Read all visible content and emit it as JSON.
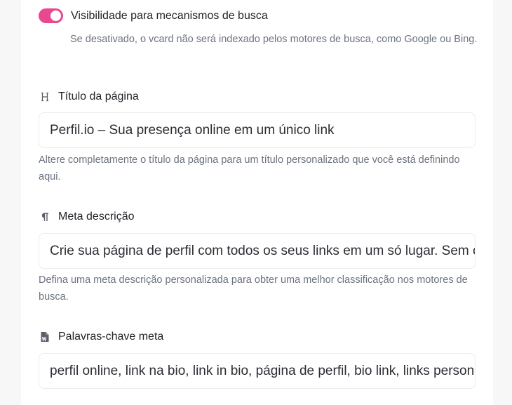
{
  "search_visibility": {
    "enabled": true,
    "label": "Visibilidade para mecanismos de busca",
    "help": "Se desativado, o vcard não será indexado pelos motores de busca, como Google ou Bing."
  },
  "page_title": {
    "icon": "heading-icon",
    "label": "Título da página",
    "value": "Perfil.io – Sua presença online em um único link",
    "help": "Altere completamente o título da página para um título personalizado que você está definindo aqui."
  },
  "meta_description": {
    "icon": "paragraph-icon",
    "label": "Meta descrição",
    "value": "Crie sua página de perfil com todos os seus links em um só lugar. Sem complicação",
    "help": "Defina uma meta descrição personalizada para obter uma melhor classificação nos motores de busca."
  },
  "meta_keywords": {
    "icon": "word-file-icon",
    "label": "Palavras-chave meta",
    "value": "perfil online, link na bio, link in bio, página de perfil, bio link, links personalizados"
  },
  "colors": {
    "accent": "#e8488f",
    "muted_text": "#6b7280"
  }
}
